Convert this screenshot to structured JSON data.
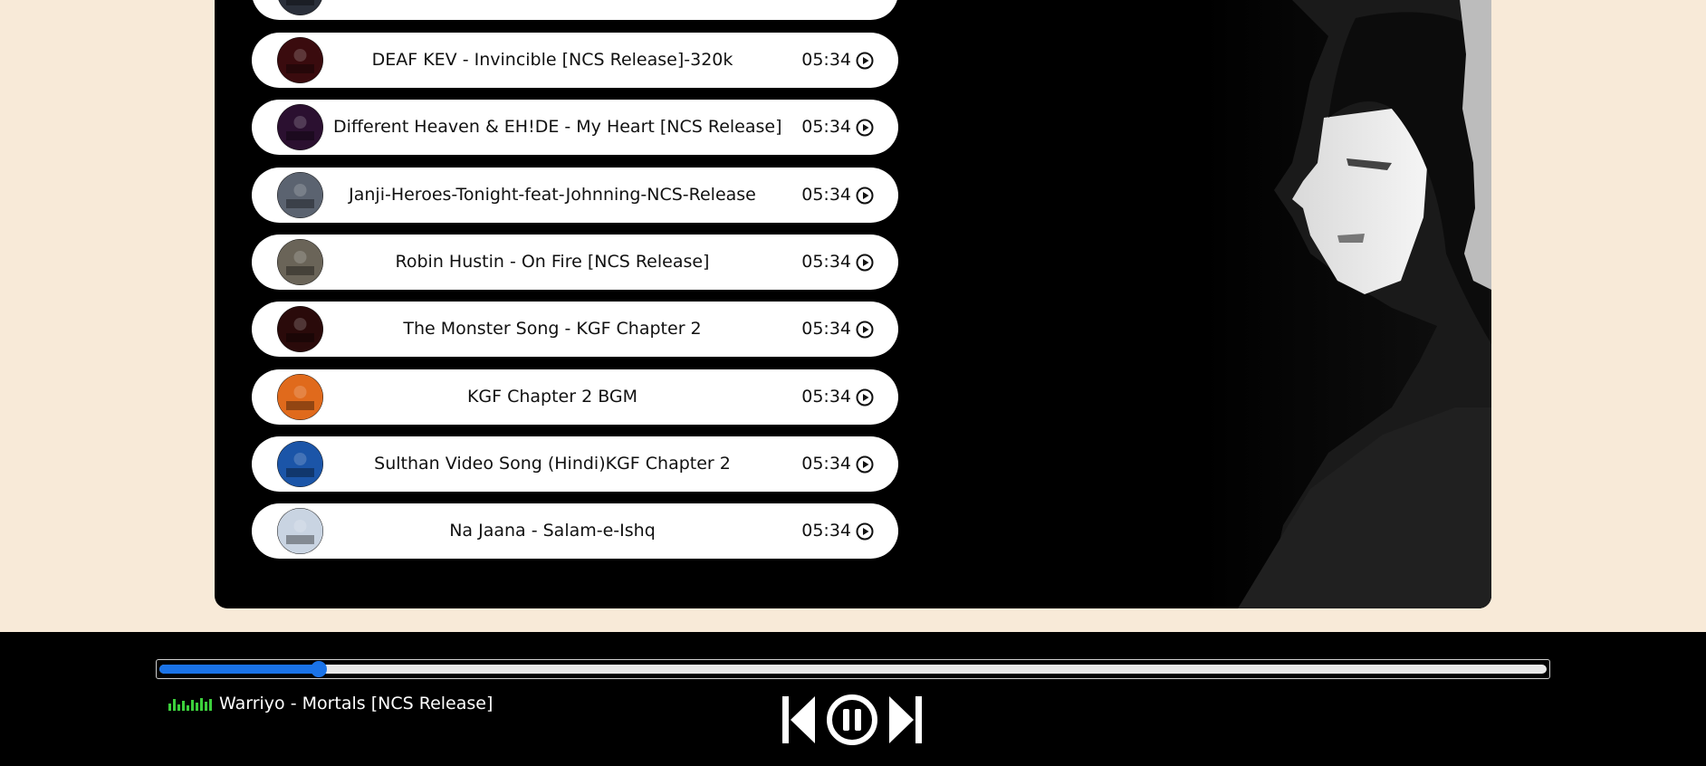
{
  "playlist": [
    {
      "title": "",
      "duration": "",
      "thumb_color": "#2a2f3a"
    },
    {
      "title": "DEAF KEV - Invincible [NCS Release]-320k",
      "duration": "05:34",
      "thumb_color": "#3a0b0e"
    },
    {
      "title": "Different Heaven & EH!DE - My Heart [NCS Release]",
      "duration": "05:34",
      "thumb_color": "#2b1030"
    },
    {
      "title": "Janji-Heroes-Tonight-feat-Johnning-NCS-Release",
      "duration": "05:34",
      "thumb_color": "#5b6370"
    },
    {
      "title": "Robin Hustin - On Fire [NCS Release]",
      "duration": "05:34",
      "thumb_color": "#6a6458"
    },
    {
      "title": "The Monster Song - KGF Chapter 2",
      "duration": "05:34",
      "thumb_color": "#2a0a0a"
    },
    {
      "title": "KGF Chapter 2 BGM",
      "duration": "05:34",
      "thumb_color": "#e06a1c"
    },
    {
      "title": "Sulthan Video Song (Hindi)KGF Chapter 2",
      "duration": "05:34",
      "thumb_color": "#1b55a8"
    },
    {
      "title": "Na Jaana - Salam-e-Ishq",
      "duration": "05:34",
      "thumb_color": "#c9d4e2"
    }
  ],
  "player": {
    "now_playing": "Warriyo - Mortals [NCS Release]",
    "progress": 0.115,
    "state": "playing",
    "icons": {
      "previous": "skip-back-icon",
      "pause": "pause-circle-icon",
      "next": "skip-forward-icon",
      "equalizer": "equalizer-icon"
    },
    "colors": {
      "accent": "#1a73e8",
      "equalizer": "#3ccf3c"
    }
  },
  "theme": {
    "page_bg": "#f8ead8",
    "panel_bg": "#000000"
  }
}
